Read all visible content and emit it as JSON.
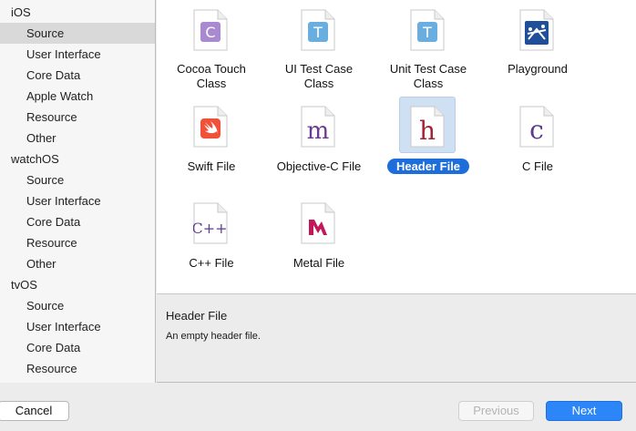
{
  "sidebar": {
    "groups": [
      {
        "platform": "iOS",
        "items": [
          "Source",
          "User Interface",
          "Core Data",
          "Apple Watch",
          "Resource",
          "Other"
        ]
      },
      {
        "platform": "watchOS",
        "items": [
          "Source",
          "User Interface",
          "Core Data",
          "Resource",
          "Other"
        ]
      },
      {
        "platform": "tvOS",
        "items": [
          "Source",
          "User Interface",
          "Core Data",
          "Resource"
        ]
      }
    ]
  },
  "templates": [
    {
      "line1": "Cocoa Touch",
      "line2": "Class",
      "glyph": "C",
      "icon": "cocoa-touch-class-icon",
      "color": "#9b78c6"
    },
    {
      "line1": "UI Test Case",
      "line2": "Class",
      "glyph": "T",
      "icon": "ui-test-case-class-icon",
      "color": "#5ea3d6"
    },
    {
      "line1": "Unit Test Case",
      "line2": "Class",
      "glyph": "T",
      "icon": "unit-test-case-class-icon",
      "color": "#5ea3d6"
    },
    {
      "line1": "Playground",
      "line2": "",
      "glyph": "",
      "icon": "playground-icon",
      "color": "#1f4f9a"
    },
    {
      "line1": "Swift File",
      "line2": "",
      "glyph": "",
      "icon": "swift-file-icon",
      "color": "#f05138"
    },
    {
      "line1": "Objective-C File",
      "line2": "",
      "glyph": "m",
      "icon": "objective-c-file-icon",
      "color": "#6a3b8f"
    },
    {
      "line1": "Header File",
      "line2": "",
      "glyph": "h",
      "icon": "header-file-icon",
      "color": "#a3233a"
    },
    {
      "line1": "C File",
      "line2": "",
      "glyph": "c",
      "icon": "c-file-icon",
      "color": "#5e3a8c"
    },
    {
      "line1": "C++ File",
      "line2": "",
      "glyph": "C++",
      "icon": "cpp-file-icon",
      "color": "#5e3a8c"
    },
    {
      "line1": "Metal File",
      "line2": "",
      "glyph": "",
      "icon": "metal-file-icon",
      "color": "#c2185b"
    }
  ],
  "description": {
    "title": "Header File",
    "text": "An empty header file."
  },
  "buttons": {
    "cancel": "Cancel",
    "previous": "Previous",
    "next": "Next"
  }
}
